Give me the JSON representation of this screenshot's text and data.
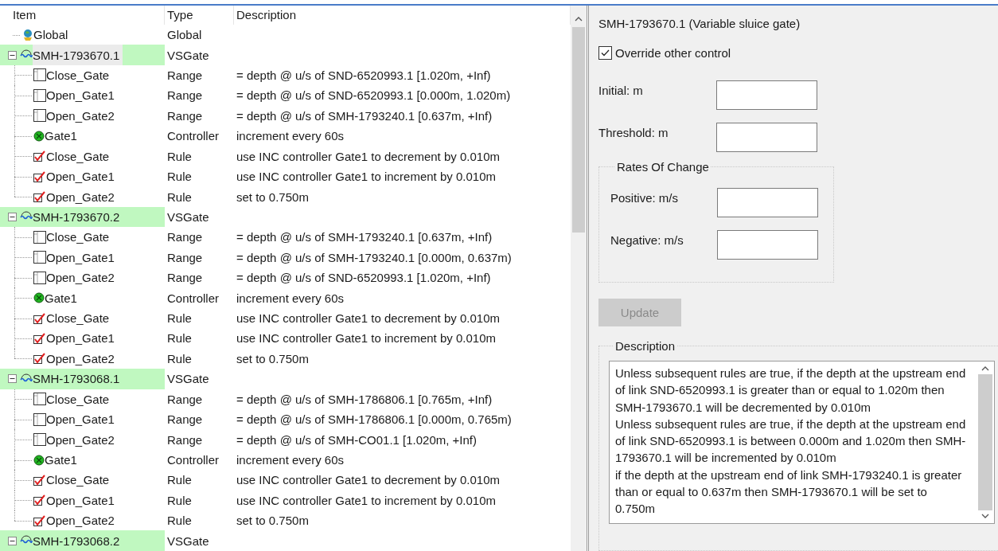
{
  "tree": {
    "columns": [
      "Item",
      "Type",
      "Description"
    ],
    "items": [
      {
        "kind": "global",
        "label": "Global",
        "type": "Global"
      },
      {
        "kind": "gate",
        "label": "SMH-1793670.1",
        "type": "VSGate",
        "expanded": true,
        "selected": true,
        "highlighted": true,
        "children": [
          {
            "kind": "range",
            "label": "Close_Gate",
            "type": "Range",
            "description": "= depth @ u/s of SND-6520993.1 [1.020m, +Inf)"
          },
          {
            "kind": "range",
            "label": "Open_Gate1",
            "type": "Range",
            "description": "= depth @ u/s of SND-6520993.1 [0.000m, 1.020m)"
          },
          {
            "kind": "range",
            "label": "Open_Gate2",
            "type": "Range",
            "description": "= depth @ u/s of SMH-1793240.1 [0.637m, +Inf)"
          },
          {
            "kind": "controller",
            "label": "Gate1",
            "type": "Controller",
            "description": "increment every 60s"
          },
          {
            "kind": "rule",
            "label": "Close_Gate",
            "type": "Rule",
            "description": "use INC controller Gate1 to decrement by 0.010m"
          },
          {
            "kind": "rule",
            "label": "Open_Gate1",
            "type": "Rule",
            "description": "use INC controller Gate1 to increment by 0.010m"
          },
          {
            "kind": "rule",
            "label": "Open_Gate2",
            "type": "Rule",
            "description": "set to 0.750m"
          }
        ]
      },
      {
        "kind": "gate",
        "label": "SMH-1793670.2",
        "type": "VSGate",
        "expanded": true,
        "selected": false,
        "highlighted": true,
        "children": [
          {
            "kind": "range",
            "label": "Close_Gate",
            "type": "Range",
            "description": "= depth @ u/s of SMH-1793240.1 [0.637m, +Inf)"
          },
          {
            "kind": "range",
            "label": "Open_Gate1",
            "type": "Range",
            "description": "= depth @ u/s of SMH-1793240.1 [0.000m, 0.637m)"
          },
          {
            "kind": "range",
            "label": "Open_Gate2",
            "type": "Range",
            "description": "= depth @ u/s of SND-6520993.1 [1.020m, +Inf)"
          },
          {
            "kind": "controller",
            "label": "Gate1",
            "type": "Controller",
            "description": "increment every 60s"
          },
          {
            "kind": "rule",
            "label": "Close_Gate",
            "type": "Rule",
            "description": "use INC controller Gate1 to decrement by 0.010m"
          },
          {
            "kind": "rule",
            "label": "Open_Gate1",
            "type": "Rule",
            "description": "use INC controller Gate1 to increment by 0.010m"
          },
          {
            "kind": "rule",
            "label": "Open_Gate2",
            "type": "Rule",
            "description": "set to 0.750m"
          }
        ]
      },
      {
        "kind": "gate",
        "label": "SMH-1793068.1",
        "type": "VSGate",
        "expanded": true,
        "selected": false,
        "highlighted": true,
        "children": [
          {
            "kind": "range",
            "label": "Close_Gate",
            "type": "Range",
            "description": "= depth @ u/s of SMH-1786806.1 [0.765m, +Inf)"
          },
          {
            "kind": "range",
            "label": "Open_Gate1",
            "type": "Range",
            "description": "= depth @ u/s of SMH-1786806.1 [0.000m, 0.765m)"
          },
          {
            "kind": "range",
            "label": "Open_Gate2",
            "type": "Range",
            "description": "= depth @ u/s of SMH-CO01.1 [1.020m, +Inf)"
          },
          {
            "kind": "controller",
            "label": "Gate1",
            "type": "Controller",
            "description": "increment every 60s"
          },
          {
            "kind": "rule",
            "label": "Close_Gate",
            "type": "Rule",
            "description": "use INC controller Gate1 to decrement by 0.010m"
          },
          {
            "kind": "rule",
            "label": "Open_Gate1",
            "type": "Rule",
            "description": "use INC controller Gate1 to increment by 0.010m"
          },
          {
            "kind": "rule",
            "label": "Open_Gate2",
            "type": "Rule",
            "description": "set to 0.750m"
          }
        ]
      },
      {
        "kind": "gate",
        "label": "SMH-1793068.2",
        "type": "VSGate",
        "expanded": true,
        "selected": false,
        "highlighted": true
      }
    ]
  },
  "details": {
    "title": "SMH-1793670.1 (Variable sluice gate)",
    "override": {
      "label": "Override other control",
      "checked": true
    },
    "fields": [
      {
        "label": "Initial: m"
      },
      {
        "label": "Threshold: m"
      }
    ],
    "rates": {
      "title": "Rates Of Change",
      "fields": [
        {
          "label": "Positive: m/s"
        },
        {
          "label": "Negative: m/s"
        }
      ]
    },
    "update_button": {
      "label": "Update",
      "disabled": true
    },
    "description": {
      "title": "Description",
      "paragraphs": [
        "Unless subsequent rules are true, if the depth at the upstream end of link SND-6520993.1 is greater than or equal to 1.020m then SMH-1793670.1 will be decremented by 0.010m",
        "Unless subsequent rules are true, if the depth at the upstream end of link SND-6520993.1 is between 0.000m and 1.020m then SMH-1793670.1 will be incremented by 0.010m",
        "if the depth at the upstream end of link SMH-1793240.1 is greater than or equal to 0.637m then SMH-1793670.1 will be set to 0.750m"
      ]
    }
  }
}
